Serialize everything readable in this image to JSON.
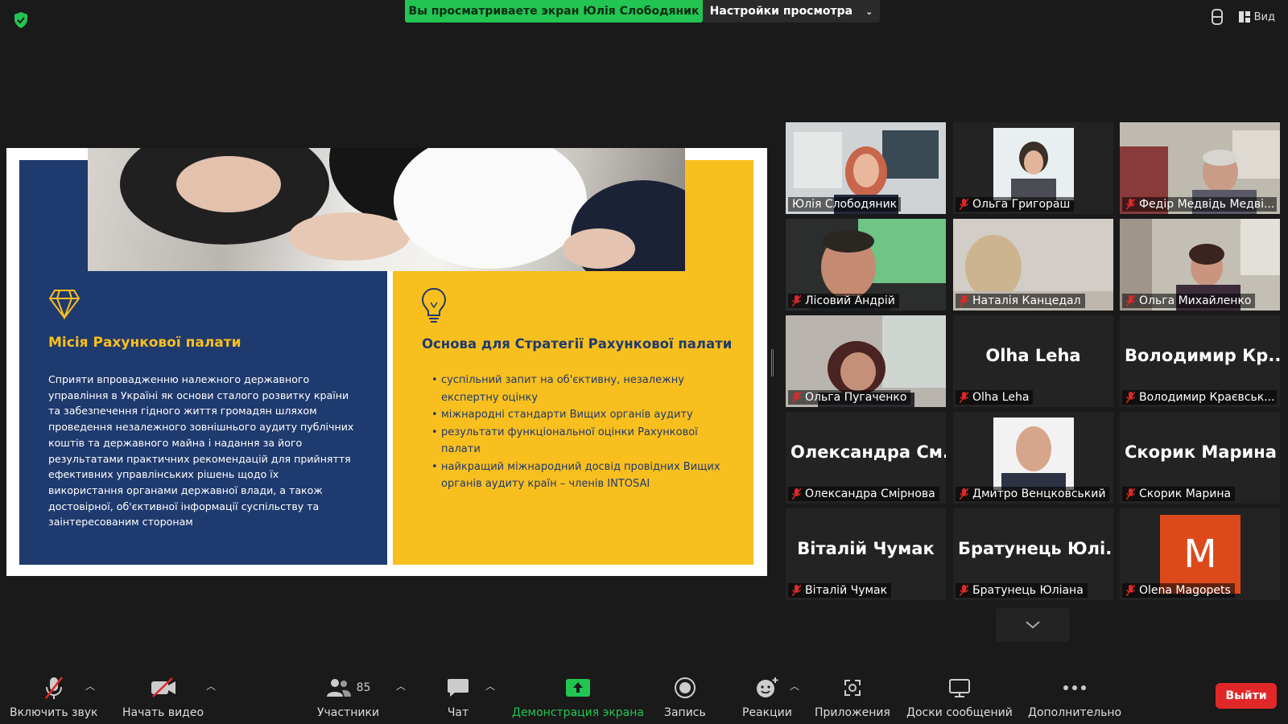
{
  "top": {
    "share_banner": "Вы просматриваете экран Юлія Слободяник",
    "view_settings": "Настройки просмотра",
    "view_button": "Вид"
  },
  "slide": {
    "mission_title": "Місія Рахункової палати",
    "mission_text": "Сприяти впровадженню належного державного управління в Україні як основи сталого розвитку країни та забезпечення гідного життя громадян шляхом проведення незалежного зовнішнього аудиту публічних коштів та державного майна і надання за його результатами практичних рекомендацій для прийняття ефективних управлінських рішень щодо їх використання органами державної влади, а також достовірної, об'єктивної інформації суспільству та заінтересованим сторонам",
    "strategy_title": "Основа для Стратегії Рахункової палати",
    "strategy_items": [
      "суспільний запит на об'єктивну, незалежну експертну оцінку",
      "міжнародні стандарти Вищих органів аудиту",
      "результати функціональної оцінки Рахункової палати",
      "найкращий міжнародний досвід провідних Вищих органів аудиту країн – членів INTOSAI"
    ]
  },
  "participants": [
    {
      "label": "Юлія Слободяник",
      "display": "",
      "muted": false,
      "active": true,
      "video": "woman-office"
    },
    {
      "label": "Ольга Григораш",
      "display": "",
      "muted": true,
      "video": "portrait-woman"
    },
    {
      "label": "Федір Медвідь Медві...",
      "display": "",
      "muted": true,
      "video": "man-office"
    },
    {
      "label": "Лісовий Андрій",
      "display": "",
      "muted": true,
      "video": "man-screen"
    },
    {
      "label": "Наталія Канцедал",
      "display": "",
      "muted": true,
      "video": "woman-blur"
    },
    {
      "label": "Ольга Михайленко",
      "display": "",
      "muted": true,
      "video": "woman-room"
    },
    {
      "label": "Ольга Пугаченко",
      "display": "",
      "muted": true,
      "video": "woman-dark"
    },
    {
      "label": "Olha Leha",
      "display": "Olha Leha",
      "muted": true,
      "video": ""
    },
    {
      "label": "Володимир Краєвськ...",
      "display": "Володимир Кр...",
      "muted": true,
      "video": ""
    },
    {
      "label": "Олександра Смірнова",
      "display": "Олександра См...",
      "muted": true,
      "video": ""
    },
    {
      "label": "Дмитро Венцковський",
      "display": "",
      "muted": true,
      "video": "portrait-man"
    },
    {
      "label": "Скорик Марина",
      "display": "Скорик Марина",
      "muted": true,
      "video": ""
    },
    {
      "label": "Віталій Чумак",
      "display": "Віталій Чумак",
      "muted": true,
      "video": ""
    },
    {
      "label": "Братунець Юліана",
      "display": "Братунець Юлі...",
      "muted": true,
      "video": ""
    },
    {
      "label": "Olena Magopets",
      "display": "",
      "muted": true,
      "video": "avatar-letter",
      "avatar_letter": "M"
    }
  ],
  "toolbar": {
    "unmute": "Включить звук",
    "start_video": "Начать видео",
    "participants": "Участники",
    "participants_count": "85",
    "chat": "Чат",
    "share_screen": "Демонстрация экрана",
    "record": "Запись",
    "reactions": "Реакции",
    "apps": "Приложения",
    "whiteboards": "Доски сообщений",
    "more": "Дополнительно",
    "leave": "Выйти"
  },
  "colors": {
    "share_green": "#23c552",
    "slide_blue": "#1f3a6e",
    "slide_yellow": "#f9bf1e",
    "leave_red": "#e02828",
    "active_speaker": "#b6e06b",
    "avatar_orange": "#dc4a1b"
  }
}
